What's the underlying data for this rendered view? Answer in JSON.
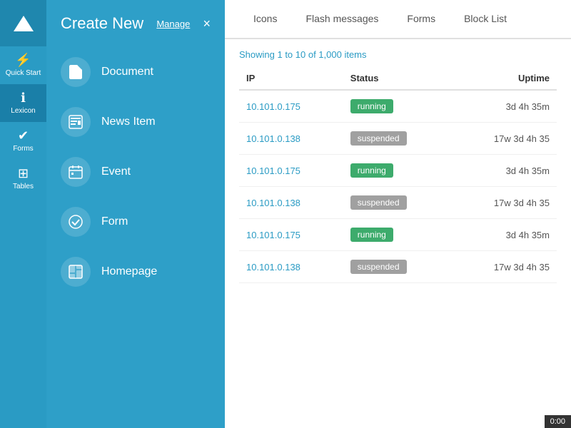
{
  "sidebar": {
    "items": [
      {
        "icon": "⚡",
        "label": "Quick Start",
        "active": false
      },
      {
        "icon": "ℹ",
        "label": "Lexicon",
        "active": true
      },
      {
        "icon": "✔",
        "label": "Forms",
        "active": false
      },
      {
        "icon": "⊞",
        "label": "Tables",
        "active": false
      }
    ]
  },
  "dropdown": {
    "title": "Create New",
    "manage_label": "Manage",
    "close_label": "×",
    "items": [
      {
        "icon": "📄",
        "label": "Document"
      },
      {
        "icon": "📰",
        "label": "News Item"
      },
      {
        "icon": "📅",
        "label": "Event"
      },
      {
        "icon": "✅",
        "label": "Form"
      },
      {
        "icon": "🖥",
        "label": "Homepage"
      }
    ]
  },
  "tabs": [
    {
      "label": "Icons",
      "active": false
    },
    {
      "label": "Flash messages",
      "active": false
    },
    {
      "label": "Forms",
      "active": false
    },
    {
      "label": "Block List",
      "active": false
    }
  ],
  "table": {
    "items_count": "Showing 1 to 10 of 1,000 items",
    "columns": [
      "IP",
      "Status",
      "Uptime"
    ],
    "rows": [
      {
        "ip": "10.101.0.175",
        "status": "running",
        "uptime": "3d 4h 35m"
      },
      {
        "ip": "10.101.0.138",
        "status": "suspended",
        "uptime": "17w 3d 4h 35"
      },
      {
        "ip": "10.101.0.175",
        "status": "running",
        "uptime": "3d 4h 35m"
      },
      {
        "ip": "10.101.0.138",
        "status": "suspended",
        "uptime": "17w 3d 4h 35"
      },
      {
        "ip": "10.101.0.175",
        "status": "running",
        "uptime": "3d 4h 35m"
      },
      {
        "ip": "10.101.0.138",
        "status": "suspended",
        "uptime": "17w 3d 4h 35"
      }
    ]
  },
  "clock": "0:00"
}
